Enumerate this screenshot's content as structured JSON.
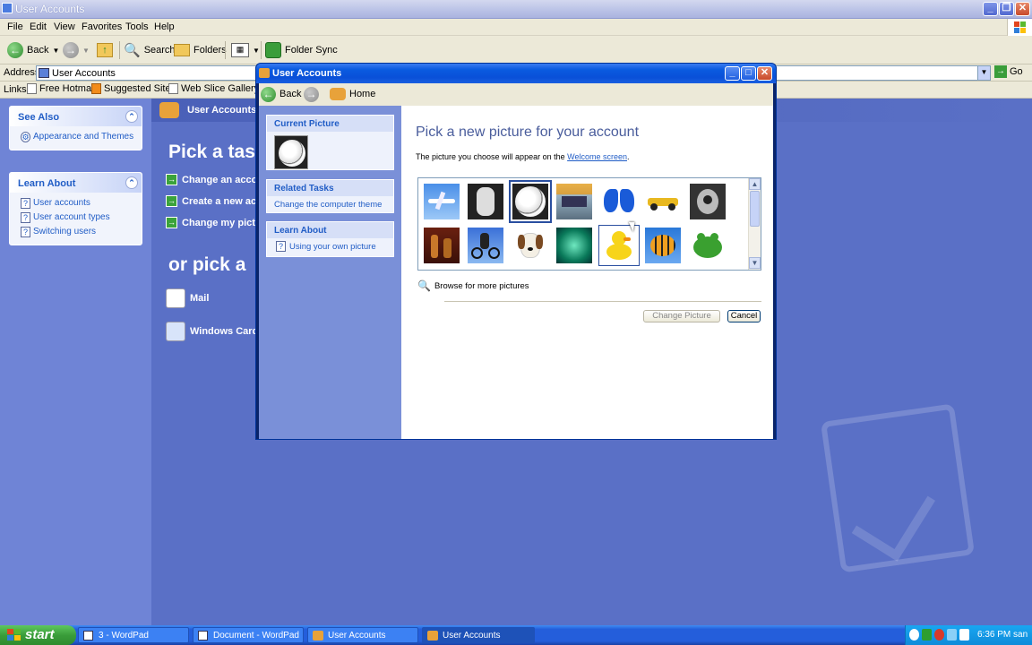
{
  "main_window": {
    "title": "User Accounts",
    "menus": [
      "File",
      "Edit",
      "View",
      "Favorites",
      "Tools",
      "Help"
    ],
    "toolbar": {
      "back": "Back",
      "search": "Search",
      "folders": "Folders",
      "folder_sync": "Folder Sync"
    },
    "address": {
      "label": "Address",
      "value": "User Accounts",
      "go": "Go"
    },
    "links": {
      "label": "Links",
      "items": [
        "Free Hotmail",
        "Suggested Sites",
        "Web Slice Gallery"
      ]
    }
  },
  "left_pane": {
    "see_also": {
      "title": "See Also",
      "items": [
        "Appearance and Themes"
      ]
    },
    "learn_about": {
      "title": "Learn About",
      "items": [
        "User accounts",
        "User account types",
        "Switching users"
      ]
    }
  },
  "content": {
    "header": "User Accounts",
    "pick_task": "Pick a tas",
    "tasks": [
      "Change an accoun",
      "Create a new acco",
      "Change my pictur"
    ],
    "or_pick": "or pick a",
    "accounts": [
      "Mail",
      "Windows Cards"
    ]
  },
  "dialog": {
    "title": "User Accounts",
    "nav": {
      "back": "Back",
      "home": "Home"
    },
    "current_picture": "Current Picture",
    "related_tasks": {
      "title": "Related Tasks",
      "items": [
        "Change the computer theme"
      ]
    },
    "learn_about": {
      "title": "Learn About",
      "items": [
        "Using your own picture"
      ]
    },
    "heading": "Pick a new picture for your account",
    "subtext": "The picture you choose will appear on the",
    "welcome_link": "Welcome screen",
    "subtext_end": ".",
    "browse": "Browse for more pictures",
    "change_button": "Change Picture",
    "cancel_button": "Cancel",
    "pictures": [
      "airplane",
      "astronaut",
      "soccer-ball",
      "beach-chair",
      "butterfly",
      "car",
      "guitar",
      "chess",
      "dirt-bike",
      "dog",
      "fish-bowl",
      "duck",
      "fish",
      "frog"
    ],
    "selected_picture": "soccer-ball",
    "hover_picture": "duck"
  },
  "taskbar": {
    "start": "start",
    "items": [
      "3 - WordPad",
      "Document - WordPad",
      "User Accounts",
      "User Accounts"
    ],
    "active_index": 3,
    "clock": "6:36 PM san"
  }
}
